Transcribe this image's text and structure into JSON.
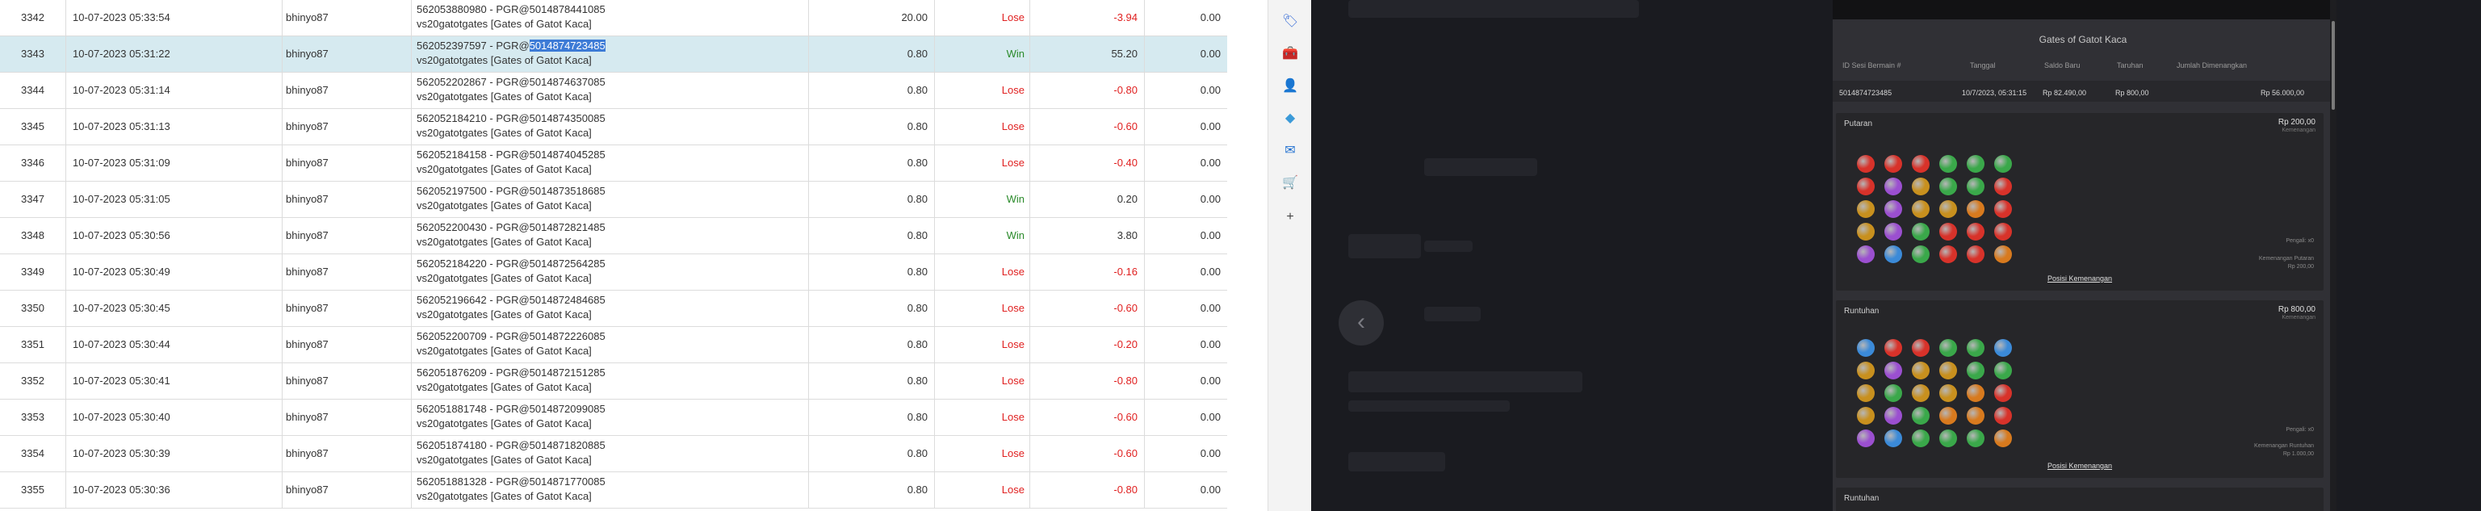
{
  "table": {
    "rows": [
      {
        "id": "3342",
        "datetime": "10-07-2023 05:33:54",
        "user": "bhinyo87",
        "tx_main": "562053880980 - PGR@5014878441085",
        "tx_pre": "",
        "tx_hl": "",
        "game": "vs20gatotgates [Gates of Gatot Kaca]",
        "bet": "20.00",
        "result": "Lose",
        "profit": "-3.94",
        "extra": "0.00"
      },
      {
        "id": "3343",
        "datetime": "10-07-2023 05:31:22",
        "user": "bhinyo87",
        "tx_main": "",
        "tx_pre": "562052397597 - PGR@",
        "tx_hl": "5014874723485",
        "game": "vs20gatotgates [Gates of Gatot Kaca]",
        "bet": "0.80",
        "result": "Win",
        "profit": "55.20",
        "extra": "0.00"
      },
      {
        "id": "3344",
        "datetime": "10-07-2023 05:31:14",
        "user": "bhinyo87",
        "tx_main": "562052202867 - PGR@5014874637085",
        "tx_pre": "",
        "tx_hl": "",
        "game": "vs20gatotgates [Gates of Gatot Kaca]",
        "bet": "0.80",
        "result": "Lose",
        "profit": "-0.80",
        "extra": "0.00"
      },
      {
        "id": "3345",
        "datetime": "10-07-2023 05:31:13",
        "user": "bhinyo87",
        "tx_main": "562052184210 - PGR@5014874350085",
        "tx_pre": "",
        "tx_hl": "",
        "game": "vs20gatotgates [Gates of Gatot Kaca]",
        "bet": "0.80",
        "result": "Lose",
        "profit": "-0.60",
        "extra": "0.00"
      },
      {
        "id": "3346",
        "datetime": "10-07-2023 05:31:09",
        "user": "bhinyo87",
        "tx_main": "562052184158 - PGR@5014874045285",
        "tx_pre": "",
        "tx_hl": "",
        "game": "vs20gatotgates [Gates of Gatot Kaca]",
        "bet": "0.80",
        "result": "Lose",
        "profit": "-0.40",
        "extra": "0.00"
      },
      {
        "id": "3347",
        "datetime": "10-07-2023 05:31:05",
        "user": "bhinyo87",
        "tx_main": "562052197500 - PGR@5014873518685",
        "tx_pre": "",
        "tx_hl": "",
        "game": "vs20gatotgates [Gates of Gatot Kaca]",
        "bet": "0.80",
        "result": "Win",
        "profit": "0.20",
        "extra": "0.00"
      },
      {
        "id": "3348",
        "datetime": "10-07-2023 05:30:56",
        "user": "bhinyo87",
        "tx_main": "562052200430 - PGR@5014872821485",
        "tx_pre": "",
        "tx_hl": "",
        "game": "vs20gatotgates [Gates of Gatot Kaca]",
        "bet": "0.80",
        "result": "Win",
        "profit": "3.80",
        "extra": "0.00"
      },
      {
        "id": "3349",
        "datetime": "10-07-2023 05:30:49",
        "user": "bhinyo87",
        "tx_main": "562052184220 - PGR@5014872564285",
        "tx_pre": "",
        "tx_hl": "",
        "game": "vs20gatotgates [Gates of Gatot Kaca]",
        "bet": "0.80",
        "result": "Lose",
        "profit": "-0.16",
        "extra": "0.00"
      },
      {
        "id": "3350",
        "datetime": "10-07-2023 05:30:45",
        "user": "bhinyo87",
        "tx_main": "562052196642 - PGR@5014872484685",
        "tx_pre": "",
        "tx_hl": "",
        "game": "vs20gatotgates [Gates of Gatot Kaca]",
        "bet": "0.80",
        "result": "Lose",
        "profit": "-0.60",
        "extra": "0.00"
      },
      {
        "id": "3351",
        "datetime": "10-07-2023 05:30:44",
        "user": "bhinyo87",
        "tx_main": "562052200709 - PGR@5014872226085",
        "tx_pre": "",
        "tx_hl": "",
        "game": "vs20gatotgates [Gates of Gatot Kaca]",
        "bet": "0.80",
        "result": "Lose",
        "profit": "-0.20",
        "extra": "0.00"
      },
      {
        "id": "3352",
        "datetime": "10-07-2023 05:30:41",
        "user": "bhinyo87",
        "tx_main": "562051876209 - PGR@5014872151285",
        "tx_pre": "",
        "tx_hl": "",
        "game": "vs20gatotgates [Gates of Gatot Kaca]",
        "bet": "0.80",
        "result": "Lose",
        "profit": "-0.80",
        "extra": "0.00"
      },
      {
        "id": "3353",
        "datetime": "10-07-2023 05:30:40",
        "user": "bhinyo87",
        "tx_main": "562051881748 - PGR@5014872099085",
        "tx_pre": "",
        "tx_hl": "",
        "game": "vs20gatotgates [Gates of Gatot Kaca]",
        "bet": "0.80",
        "result": "Lose",
        "profit": "-0.60",
        "extra": "0.00"
      },
      {
        "id": "3354",
        "datetime": "10-07-2023 05:30:39",
        "user": "bhinyo87",
        "tx_main": "562051874180 - PGR@5014871820885",
        "tx_pre": "",
        "tx_hl": "",
        "game": "vs20gatotgates [Gates of Gatot Kaca]",
        "bet": "0.80",
        "result": "Lose",
        "profit": "-0.60",
        "extra": "0.00"
      },
      {
        "id": "3355",
        "datetime": "10-07-2023 05:30:36",
        "user": "bhinyo87",
        "tx_main": "562051881328 - PGR@5014871770085",
        "tx_pre": "",
        "tx_hl": "",
        "game": "vs20gatotgates [Gates of Gatot Kaca]",
        "bet": "0.80",
        "result": "Lose",
        "profit": "-0.80",
        "extra": "0.00"
      }
    ]
  },
  "extensions": [
    {
      "name": "tag-icon",
      "glyph": "🏷",
      "color": "#3b6fd8"
    },
    {
      "name": "toolbox-icon",
      "glyph": "🧰",
      "color": "#d8453b"
    },
    {
      "name": "user-icon",
      "glyph": "👤",
      "color": "#8a4fc8"
    },
    {
      "name": "copilot-icon",
      "glyph": "◆",
      "color": "#3b9ad8"
    },
    {
      "name": "outlook-icon",
      "glyph": "✉",
      "color": "#1f6fd0"
    },
    {
      "name": "cart-icon",
      "glyph": "🛒",
      "color": "#2a8ad0"
    },
    {
      "name": "add-icon",
      "glyph": "+",
      "color": "#444444"
    }
  ],
  "game_panel": {
    "title": "Gates of Gatot Kaca",
    "columns": [
      "ID Sesi Bermain #",
      "Tanggal",
      "Saldo Baru",
      "Taruhan",
      "Jumlah Dimenangkan"
    ],
    "row": {
      "session": "5014874723485",
      "date": "10/7/2023, 05:31:15",
      "balance": "Rp 82.490,00",
      "bet": "Rp 800,00",
      "win": "Rp 56.000,00"
    },
    "sections": [
      {
        "title": "Putaran",
        "amount": "Rp 200,00",
        "sub": "Kemenangan",
        "note_a": "Pengali: x0",
        "note_b": "Kemenangan Putaran",
        "note_c": "Rp 200,00",
        "link": "Posisi Kemenangan"
      },
      {
        "title": "Runtuhan",
        "amount": "Rp 800,00",
        "sub": "Kemenangan",
        "note_a": "Pengali: x0",
        "note_b": "Kemenangan Runtuhan",
        "note_c": "Rp 1.000,00",
        "link": "Posisi Kemenangan"
      },
      {
        "title": "Runtuhan"
      }
    ],
    "grid1": [
      [
        "#d8322a",
        "#d8322a",
        "#d8322a",
        "#3aa84a",
        "#3aa84a",
        "#3aa84a"
      ],
      [
        "#d8322a",
        "#9b4fd0",
        "#c8901e",
        "#3aa84a",
        "#3aa84a",
        "#d8322a"
      ],
      [
        "#c8901e",
        "#9b4fd0",
        "#c8901e",
        "#c8901e",
        "#d87a1e",
        "#d8322a"
      ],
      [
        "#c8901e",
        "#9b4fd0",
        "#3aa84a",
        "#d8322a",
        "#d8322a",
        "#d8322a"
      ],
      [
        "#9b4fd0",
        "#3b8ad8",
        "#3aa84a",
        "#d8322a",
        "#d8322a",
        "#d87a1e"
      ]
    ],
    "grid2": [
      [
        "#3b8ad8",
        "#d8322a",
        "#d8322a",
        "#3aa84a",
        "#3aa84a",
        "#3b8ad8"
      ],
      [
        "#c8901e",
        "#9b4fd0",
        "#c8901e",
        "#c8901e",
        "#3aa84a",
        "#3aa84a"
      ],
      [
        "#c8901e",
        "#3aa84a",
        "#c8901e",
        "#c8901e",
        "#d87a1e",
        "#d8322a"
      ],
      [
        "#c8901e",
        "#9b4fd0",
        "#3aa84a",
        "#d87a1e",
        "#d87a1e",
        "#d8322a"
      ],
      [
        "#9b4fd0",
        "#3b8ad8",
        "#3aa84a",
        "#3aa84a",
        "#3aa84a",
        "#d87a1e"
      ]
    ]
  }
}
